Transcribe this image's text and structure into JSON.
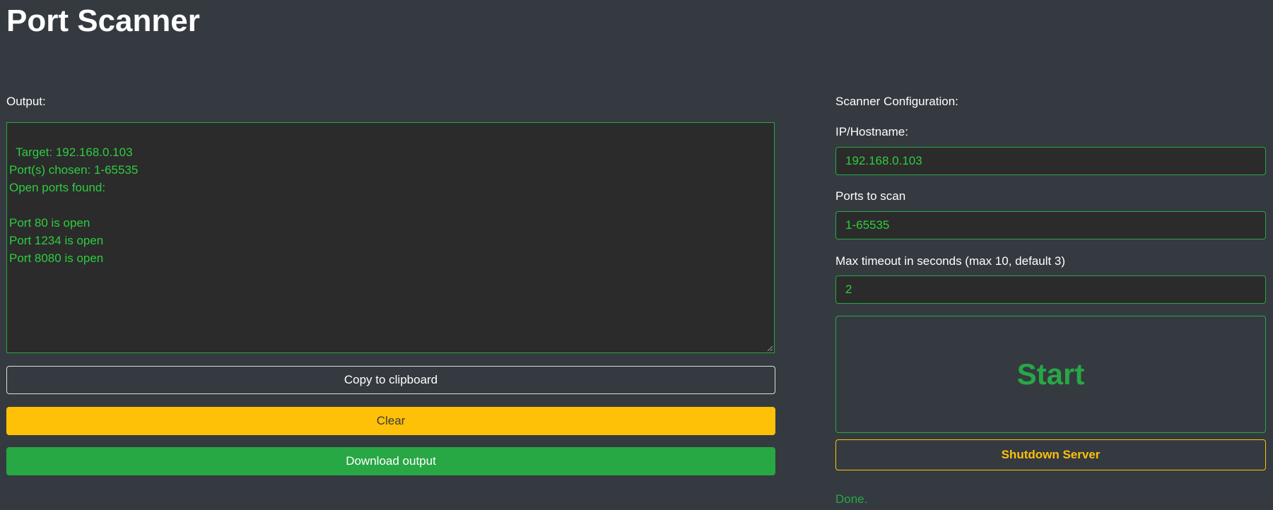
{
  "header": {
    "title": "Port Scanner"
  },
  "output": {
    "label": "Output:",
    "text": "Target: 192.168.0.103\nPort(s) chosen: 1-65535\nOpen ports found:\n\nPort 80 is open\nPort 1234 is open\nPort 8080 is open",
    "copy_button": "Copy to clipboard",
    "clear_button": "Clear",
    "download_button": "Download output"
  },
  "config": {
    "label": "Scanner Configuration:",
    "host_label": "IP/Hostname:",
    "host_value": "192.168.0.103",
    "ports_label": "Ports to scan",
    "ports_value": "1-65535",
    "timeout_label": "Max timeout in seconds (max 10, default 3)",
    "timeout_value": "2",
    "start_button": "Start",
    "shutdown_button": "Shutdown Server",
    "status": "Done."
  },
  "colors": {
    "background": "#343a40",
    "field_background": "#2b2b2b",
    "accent_green": "#28a745",
    "output_text_green": "#2ecc40",
    "warning_yellow": "#ffc107"
  },
  "icons": {
    "resize_grip": "resize-grip-icon"
  }
}
